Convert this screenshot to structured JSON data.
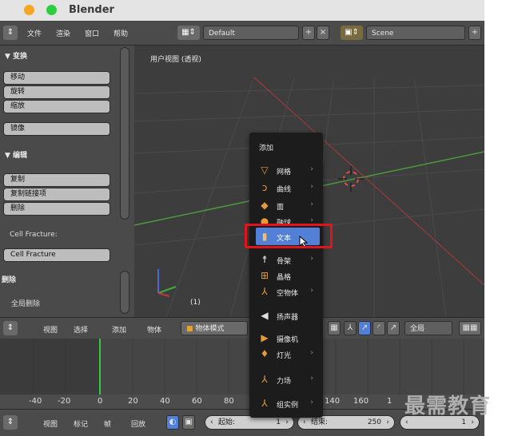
{
  "app": {
    "title": "Blender"
  },
  "menubar": {
    "items": [
      "文件",
      "渲染",
      "窗口",
      "帮助"
    ],
    "layout_value": "Default",
    "scene_value": "Scene"
  },
  "toolshelf": {
    "transform_header": "▼ 变换",
    "transform_buttons": [
      "移动",
      "旋转",
      "缩放"
    ],
    "mirror_button": "镜像",
    "edit_header": "▼ 编辑",
    "edit_buttons": [
      "复制",
      "复制链接项",
      "删除"
    ],
    "cell_fracture_label": "Cell Fracture:",
    "cell_fracture_button": "Cell Fracture",
    "delete_header": "删除",
    "delete_all": "全局删除"
  },
  "viewport": {
    "label": "用户视图 (透视)",
    "frame": "(1)"
  },
  "add_menu": {
    "title": "添加",
    "items": [
      {
        "label": "网格",
        "icon": "triangle-mesh-icon",
        "has_sub": true
      },
      {
        "label": "曲线",
        "icon": "curve-icon",
        "has_sub": true
      },
      {
        "label": "面",
        "icon": "surface-icon",
        "has_sub": true
      },
      {
        "label": "融球",
        "icon": "metaball-icon",
        "has_sub": true
      },
      {
        "label": "文本",
        "icon": "text-object-icon",
        "has_sub": false,
        "highlighted": true
      },
      {
        "label": "骨架",
        "icon": "armature-icon",
        "has_sub": true
      },
      {
        "label": "晶格",
        "icon": "lattice-icon",
        "has_sub": false
      },
      {
        "label": "空物体",
        "icon": "empty-icon",
        "has_sub": true
      },
      {
        "label": "扬声器",
        "icon": "speaker-icon",
        "has_sub": false
      },
      {
        "label": "摄像机",
        "icon": "camera-icon",
        "has_sub": false
      },
      {
        "label": "灯光",
        "icon": "lamp-icon",
        "has_sub": true
      },
      {
        "label": "力场",
        "icon": "force-field-icon",
        "has_sub": true
      },
      {
        "label": "组实例",
        "icon": "group-instance-icon",
        "has_sub": true
      }
    ]
  },
  "header3d": {
    "items": [
      "视图",
      "选择",
      "添加",
      "物体"
    ],
    "mode": "物体模式",
    "pivot": "全局"
  },
  "timeline": {
    "ticks": [
      "-40",
      "-20",
      "0",
      "20",
      "40",
      "60",
      "80",
      "140",
      "160",
      "1"
    ]
  },
  "bottombar": {
    "items": [
      "视图",
      "标记",
      "帧",
      "回放"
    ],
    "start_label": "起始:",
    "start_value": "1",
    "end_label": "结束:",
    "end_value": "250",
    "current_value": "1"
  },
  "watermark": "最需教育",
  "colors": {
    "highlight": "#5280d6",
    "red_box": "#e0141c",
    "current_frame": "#2ecc40"
  }
}
